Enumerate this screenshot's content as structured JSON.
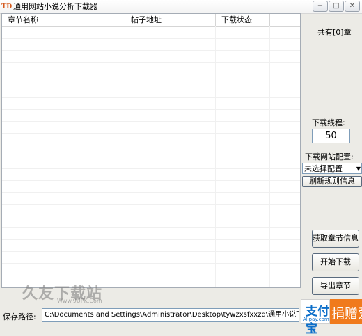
{
  "window": {
    "icon_text": "TD",
    "title": "通用网站小说分析下载器",
    "controls": {
      "minimize": "−",
      "maximize": "□",
      "close": "✕"
    }
  },
  "table": {
    "columns": [
      "章节名称",
      "帖子地址",
      "下载状态"
    ],
    "rows": []
  },
  "sidebar": {
    "count_text": "共有[0]章",
    "threads_label": "下载线程:",
    "threads_value": "50",
    "site_config_label": "下载网站配置:",
    "site_config_selected": "未选择配置",
    "refresh_rules_button": "刷新规则信息",
    "get_chapters_button": "获取章节信息",
    "start_download_button": "开始下载",
    "export_chapters_button": "导出章节"
  },
  "footer": {
    "save_path_label": "保存路径:",
    "save_path_value": "C:\\Documents and Settings\\Administrator\\Desktop\\tywzxsfxxzq\\通用小说下载器\\Downl"
  },
  "overlays": {
    "watermark": "久友下载站",
    "watermark_sub": "Www.9UPK.Com",
    "alipay_text": "支付宝",
    "alipay_sub": "Alipay.com",
    "donate_text": "捐赠爱你"
  }
}
